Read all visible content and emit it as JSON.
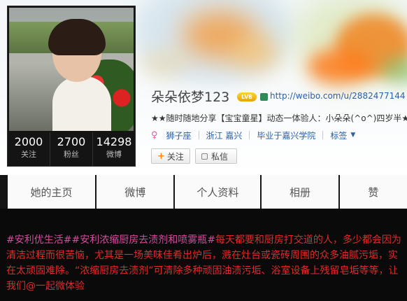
{
  "profile": {
    "name": "朵朵依梦123",
    "level_badge": "LV8",
    "url": "http://weibo.com/u/2882477144",
    "description": "★★随时随地分享【宝宝童星】动态一体验人：小朵朵(^o^)四岁半★★",
    "meta": [
      "狮子座",
      "浙江 嘉兴",
      "毕业于嘉兴学院",
      "标签"
    ],
    "stats": [
      {
        "num": "2000",
        "label": "关注"
      },
      {
        "num": "2700",
        "label": "粉丝"
      },
      {
        "num": "14298",
        "label": "微博"
      }
    ],
    "follow_label": "关注",
    "message_label": "私信"
  },
  "tabs": [
    "她的主页",
    "微博",
    "个人资料",
    "相册",
    "赞"
  ],
  "post": {
    "hashtag1": "#安利优生活#",
    "hashtag2": "#安利浓缩厨房去渍剂和喷雾瓶#",
    "text": "每天都要和厨房打交道的人，多少都会因为清洁过程而很苦恼，尤其是一场美味佳肴出炉后，溅在灶台或瓷砖周围的众多油腻污垢，实在太顽固难除。“浓缩厨房去渍剂”可清除多种顽固油渍污垢、浴室设备上残留皂垢等等，让我们@一起微体验"
  },
  "colors": {
    "accent_link": "#2c5ea5",
    "post_red": "#e02b2b",
    "hashtag_pink": "#d54b9c",
    "level_gold": "#f0b400"
  }
}
